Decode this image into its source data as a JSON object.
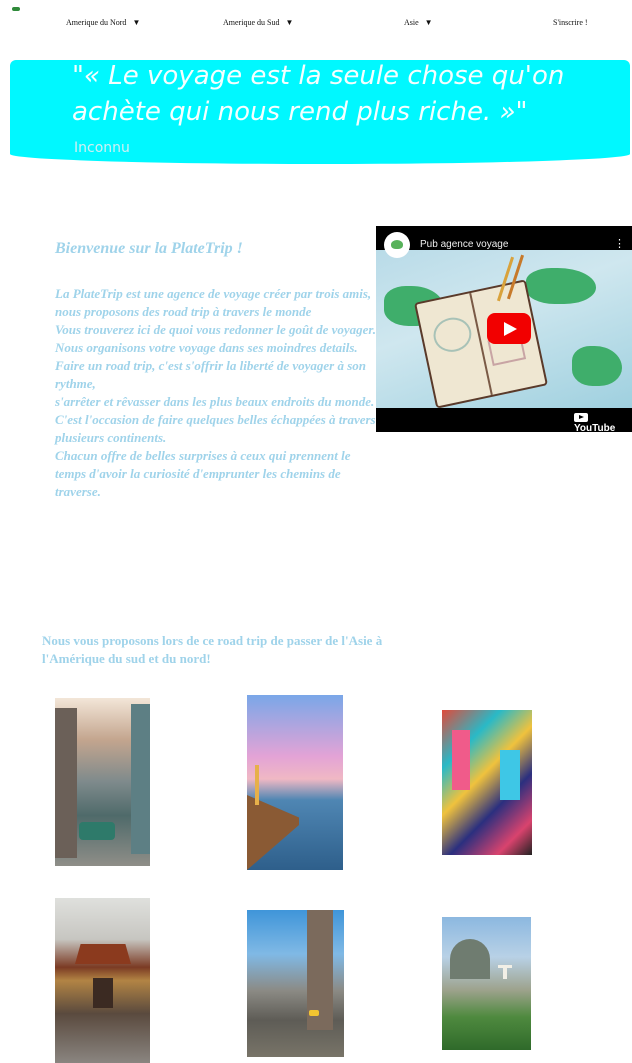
{
  "nav": {
    "items": [
      {
        "label": "Amerique du Nord",
        "caret": "▼"
      },
      {
        "label": "Amerique du Sud",
        "caret": "▼"
      },
      {
        "label": "Asie",
        "caret": "▼"
      }
    ],
    "signup": "S'inscrire !"
  },
  "banner": {
    "quote": "\"« Le voyage est la seule chose qu'on achète qui nous rend plus riche. »\"",
    "author": "Inconnu",
    "color": "#00f8ff"
  },
  "welcome": {
    "title": "Bienvenue sur la PlateTrip !",
    "paragraphs": [
      "La PlateTrip est une agence de voyage créer par trois amis,",
      "nous proposons des road trip à travers le monde",
      "Vous trouverez ici de quoi vous redonner le goût de voyager.",
      "Nous organisons votre voyage dans ses moindres details.",
      "Faire un road trip, c'est s'offrir la liberté de voyager à son rythme,",
      "s'arrêter et rêvasser dans les plus beaux endroits du monde.",
      "C'est l'occasion de faire quelques belles échappées à travers plusieurs continents.",
      "Chacun offre de belles surprises à ceux qui prennent le temps d'avoir la curiosité d'emprunter les chemins de traverse."
    ],
    "text_color": "#9fd3ea"
  },
  "video": {
    "title": "Pub agence voyage",
    "menu_icon": "⋮",
    "brand": "YouTube"
  },
  "proposal": "Nous vous proposons lors de ce road trip de passer de l'Asie à l'Amérique du sud et du nord!"
}
